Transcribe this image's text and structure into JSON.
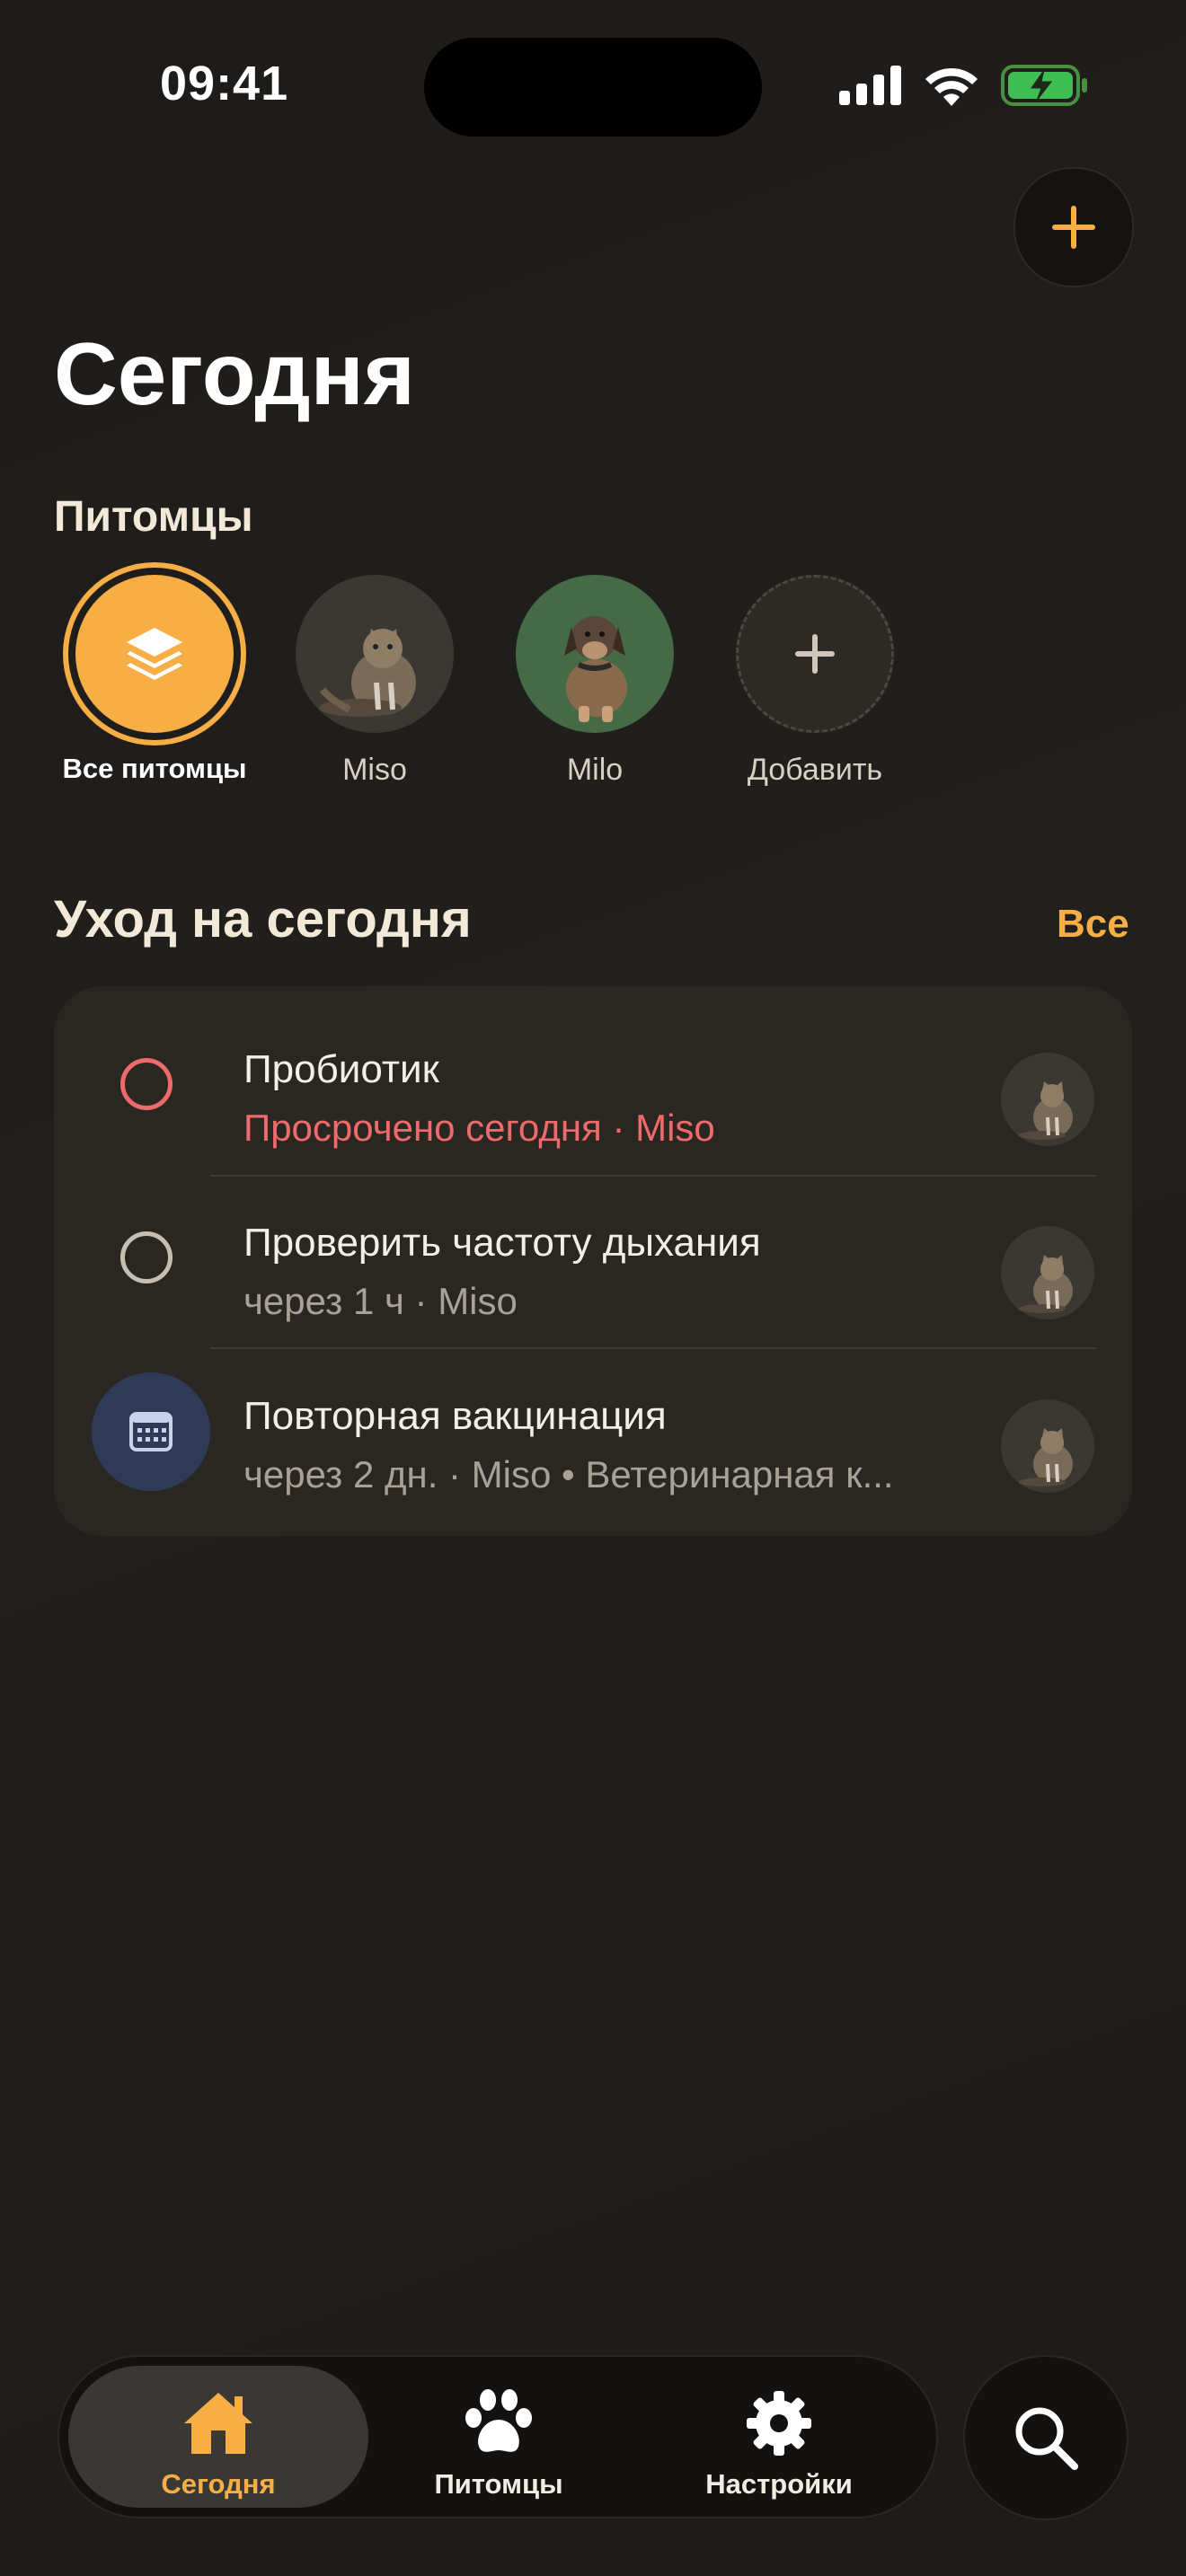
{
  "status_bar": {
    "time": "09:41"
  },
  "page": {
    "title": "Сегодня"
  },
  "pets_section": {
    "label": "Питомцы",
    "pets": [
      {
        "name": "Все питомцы",
        "selected": true,
        "icon": "stack-icon"
      },
      {
        "name": "Miso",
        "selected": false,
        "icon": "cat-avatar"
      },
      {
        "name": "Milo",
        "selected": false,
        "icon": "dog-avatar"
      },
      {
        "name": "Добавить",
        "selected": false,
        "icon": "plus-icon"
      }
    ]
  },
  "care": {
    "title": "Уход на сегодня",
    "all_link": "Все",
    "tasks": [
      {
        "title": "Пробиотик",
        "subtitle": "Просрочено сегодня · Miso",
        "status": "overdue",
        "pet": "Miso"
      },
      {
        "title": "Проверить частоту дыхания",
        "subtitle": "через 1 ч · Miso",
        "status": "pending",
        "pet": "Miso"
      },
      {
        "title": "Повторная вакцинация",
        "subtitle": "через 2 дн. · Miso • Ветеринарная к...",
        "status": "appointment",
        "pet": "Miso"
      }
    ]
  },
  "tabbar": {
    "tabs": [
      {
        "label": "Сегодня",
        "icon": "home-icon",
        "active": true
      },
      {
        "label": "Питомцы",
        "icon": "paw-icon",
        "active": false
      },
      {
        "label": "Настройки",
        "icon": "gear-icon",
        "active": false
      }
    ]
  },
  "colors": {
    "accent": "#f6ae45",
    "overdue": "#ef6a6a",
    "background": "#1f1d1a",
    "card": "#2a2723"
  }
}
